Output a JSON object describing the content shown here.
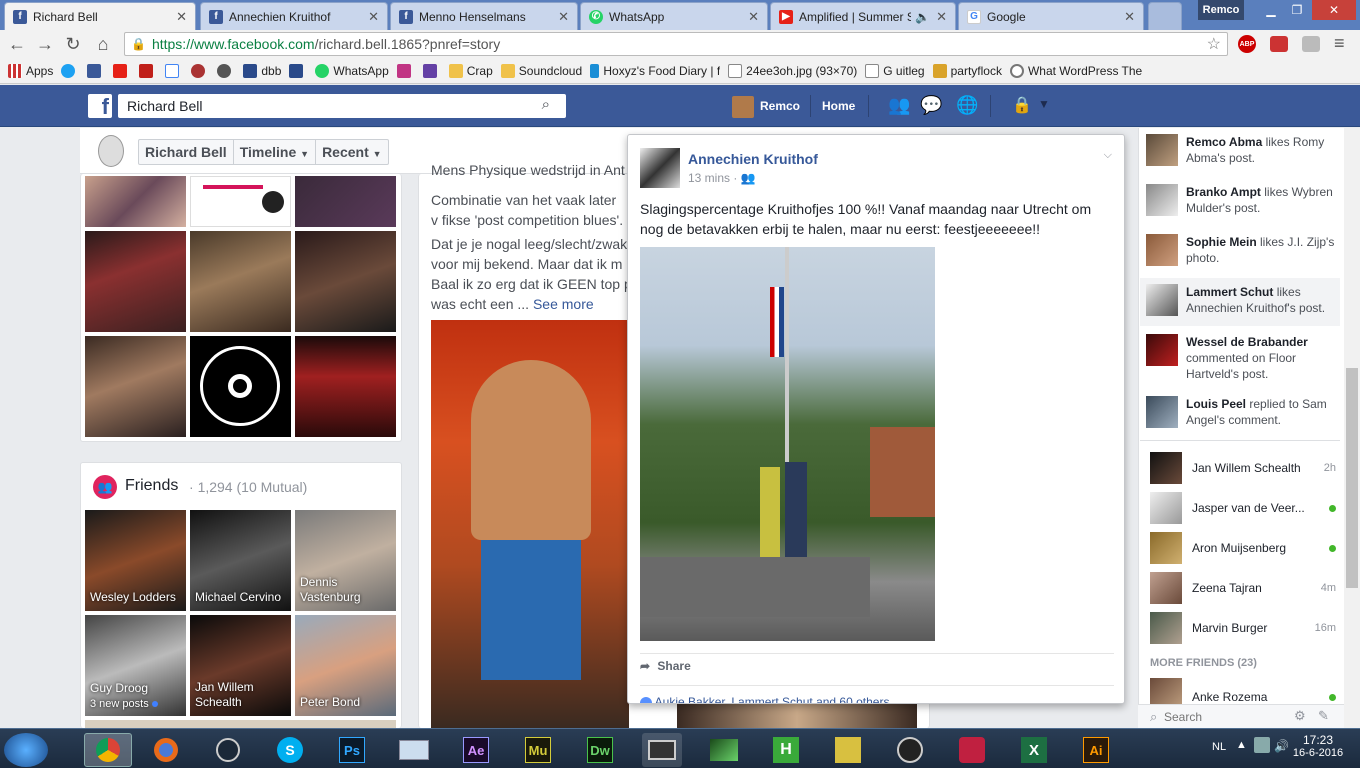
{
  "browser": {
    "tabs": [
      {
        "title": "Richard Bell",
        "icon": "facebook-icon",
        "active": true
      },
      {
        "title": "Annechien Kruithof",
        "icon": "facebook-icon",
        "active": false
      },
      {
        "title": "Menno Henselmans",
        "icon": "facebook-icon",
        "active": false
      },
      {
        "title": "WhatsApp",
        "icon": "whatsapp-icon",
        "active": false
      },
      {
        "title": "Amplified | Summer S",
        "icon": "youtube-icon",
        "active": false
      },
      {
        "title": "Google",
        "icon": "google-icon",
        "active": false
      }
    ],
    "window_user": "Remco",
    "url_host": "https://www.facebook.com",
    "url_path": "/richard.bell.1865?pnref=story",
    "bookmarks": [
      "Apps",
      "",
      "",
      "",
      "",
      "",
      "",
      "",
      "dbb",
      "",
      "WhatsApp",
      "",
      "",
      "Crap",
      "Soundcloud",
      "Hoxyz's Food Diary | f",
      "24ee3oh.jpg (93×70)",
      "G uitleg",
      "partyflock",
      "What WordPress The"
    ]
  },
  "fb": {
    "search_value": "Richard Bell",
    "user_name": "Remco",
    "home_label": "Home"
  },
  "profile": {
    "name_btn": "Richard Bell",
    "timeline_btn": "Timeline",
    "recent_btn": "Recent",
    "friends_title": "Friends",
    "friends_count": "1,294",
    "friends_mutual": "(10 Mutual)",
    "friends": [
      {
        "name": "Wesley Lodders"
      },
      {
        "name": "Michael Cervino"
      },
      {
        "name": "Dennis Vastenburg"
      },
      {
        "name": "Guy Droog",
        "sub": "3 new posts"
      },
      {
        "name": "Jan Willem Schealth"
      },
      {
        "name": "Peter Bond"
      }
    ]
  },
  "post": {
    "line_top": "Mens Physique wedstrijd in Ant",
    "p1": "Combinatie van het vaak later v fikse 'post competition blues'.",
    "p2_a": "Dat je je nogal leeg/slecht/zwak",
    "p2_b": "voor mij bekend. Maar dat ik m",
    "p2_c": "Baal ik zo erg dat ik GEEN top p",
    "p2_d": "was echt een ...",
    "see_more": "See more"
  },
  "popup": {
    "author": "Annechien Kruithof",
    "time": "13 mins",
    "text": "Slagingspercentage Kruithofjes 100 %!! Vanaf maandag naar Utrecht om nog de betavakken erbij te halen, maar nu eerst: feestjeeeeeee!!",
    "share": "Share",
    "likes": "Aukje Bakker, Lammert Schut and 60 others"
  },
  "ticker": [
    {
      "name": "Remco Abma",
      "rest": "likes Romy Abma's post."
    },
    {
      "name": "Branko Ampt",
      "rest": "likes Wybren Mulder's post."
    },
    {
      "name": "Sophie Mein",
      "rest": "likes J.I. Zijp's photo."
    },
    {
      "name": "Lammert Schut",
      "rest": "likes Annechien Kruithof's post."
    },
    {
      "name": "Wessel de Brabander",
      "rest": "commented on Floor Hartveld's post."
    },
    {
      "name": "Louis Peel",
      "rest": "replied to Sam Angel's comment."
    }
  ],
  "chat": {
    "contacts": [
      {
        "name": "Jan Willem Schealth",
        "time": "2h"
      },
      {
        "name": "Jasper van de Veer...",
        "time": ""
      },
      {
        "name": "Aron Muijsenberg",
        "time": ""
      },
      {
        "name": "Zeena Tajran",
        "time": "4m"
      },
      {
        "name": "Marvin Burger",
        "time": "16m"
      }
    ],
    "more_friends": "MORE FRIENDS (23)",
    "more_first": "Anke Rozema",
    "search_placeholder": "Search"
  },
  "taskbar": {
    "apps": [
      "start",
      "chrome",
      "firefox",
      "steam",
      "skype",
      "Ps",
      "keyboard",
      "Ae",
      "Mu",
      "Dw",
      "video",
      "sound",
      "H",
      "wolf",
      "mouse",
      "game",
      "excel",
      "Ai"
    ],
    "lang": "NL",
    "time": "17:23",
    "date": "16-6-2016"
  },
  "colors": {
    "fb_blue": "#3b5998",
    "link": "#365899"
  }
}
